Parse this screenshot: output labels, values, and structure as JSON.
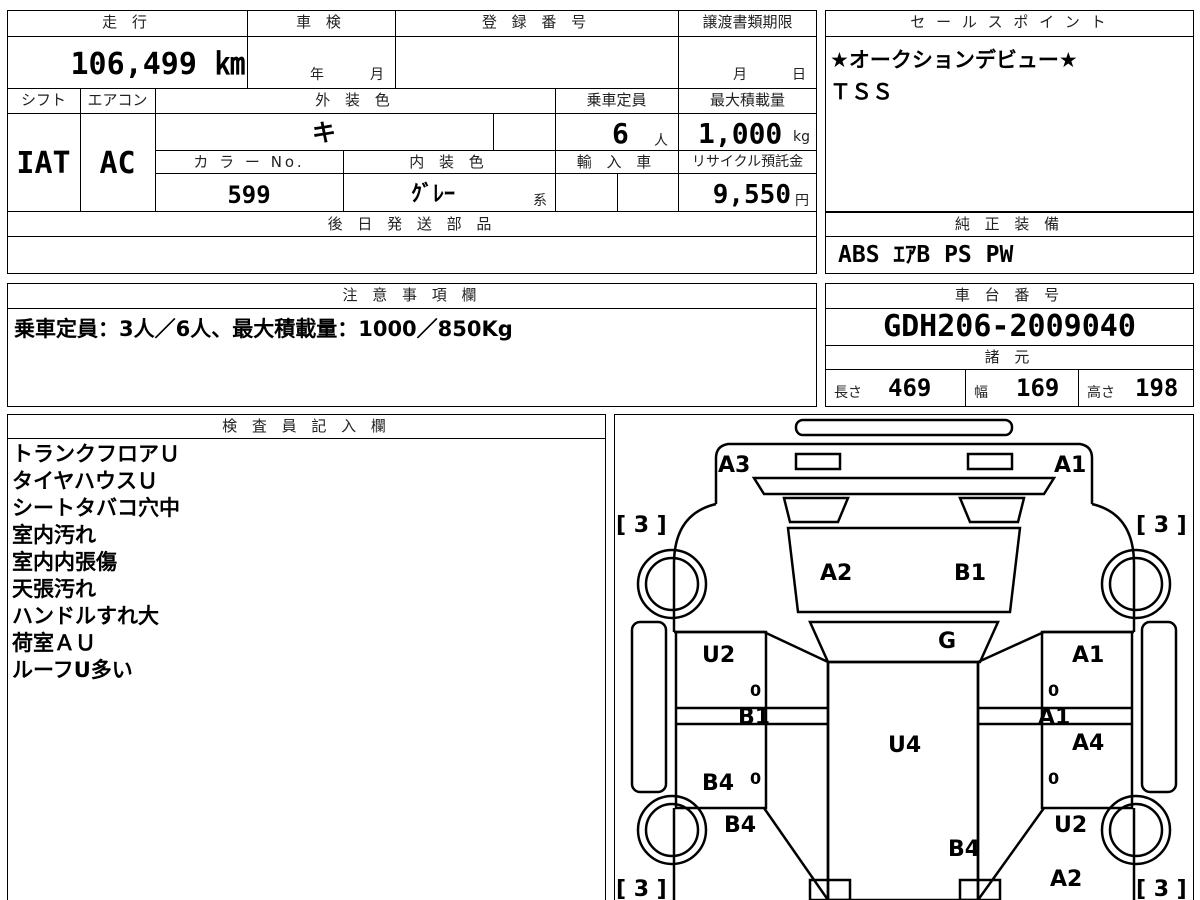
{
  "top": {
    "mileage_header": "走 行",
    "mileage": "106,499 ㎞",
    "shaken_header": "車 検",
    "shaken_year": "年",
    "shaken_month": "月",
    "reg_header": "登 録 番 号",
    "transfer_header": "譲渡書類期限",
    "transfer_month": "月",
    "transfer_day": "日",
    "selling_header": "セ ー ル ス ポ イ ン ト",
    "selling_points": [
      "★オークションデビュー★",
      "ＴＳＳ"
    ],
    "shift_header": "シフト",
    "shift": "IAT",
    "ac_header": "エアコン",
    "ac": "AC",
    "exterior_header": "外 装 色",
    "exterior": "キ",
    "capacity_header": "乗車定員",
    "capacity": "6",
    "capacity_unit": "人",
    "max_load_header": "最大積載量",
    "max_load": "1,000",
    "max_load_unit": "kg",
    "color_no_header": "カ ラ ー  No.",
    "color_no": "599",
    "interior_header": "内 装 色",
    "interior": "ｸﾞﾚｰ",
    "interior_suffix": "系",
    "import_header": "輸 入 車",
    "recycle_header": "リサイクル預託金",
    "recycle_fee": "9,550",
    "recycle_unit": "円",
    "later_parts_header": "後 日 発 送 部 品",
    "genuine_header": "純 正 装 備",
    "genuine": "ABS ｴｱB PS PW"
  },
  "notes": {
    "header": "注 意 事 項 欄",
    "text": "乗車定員：3人／6人、最大積載量：1000／850Kg"
  },
  "chassis": {
    "header": "車 台 番 号",
    "number": "GDH206-2009040",
    "specs_header": "諸 元",
    "length_label": "長さ",
    "length": "469",
    "width_label": "幅",
    "width": "169",
    "height_label": "高さ",
    "height": "198"
  },
  "inspector": {
    "header": "検 査 員 記 入 欄",
    "lines": [
      "トランクフロアＵ",
      "タイヤハウスＵ",
      "シートタバコ穴中",
      "室内汚れ",
      "室内内張傷",
      "天張汚れ",
      "ハンドルすれ大",
      "荷室ＡＵ",
      "ルーフU多い"
    ]
  },
  "diagram": {
    "tire_mark": "[ 3 ]",
    "tire_fl": "[ 3 ]",
    "tire_fr": "[ 3 ]",
    "tire_rl": "[ 3 ]",
    "tire_rr": "[ 3 ]",
    "labels": {
      "a3": "A3",
      "a1_top": "A1",
      "a2_front": "A2",
      "b1_front": "B1",
      "g": "G",
      "u2_left": "U2",
      "a1_right": "A1",
      "b1_left": "B1",
      "a1_right_mid": "A1",
      "u4": "U4",
      "a4": "A4",
      "b4_left": "B4",
      "b4_left_low": "B4",
      "u2_right": "U2",
      "b4_bottom": "B4",
      "a2_right": "A2"
    },
    "zero": "0"
  }
}
